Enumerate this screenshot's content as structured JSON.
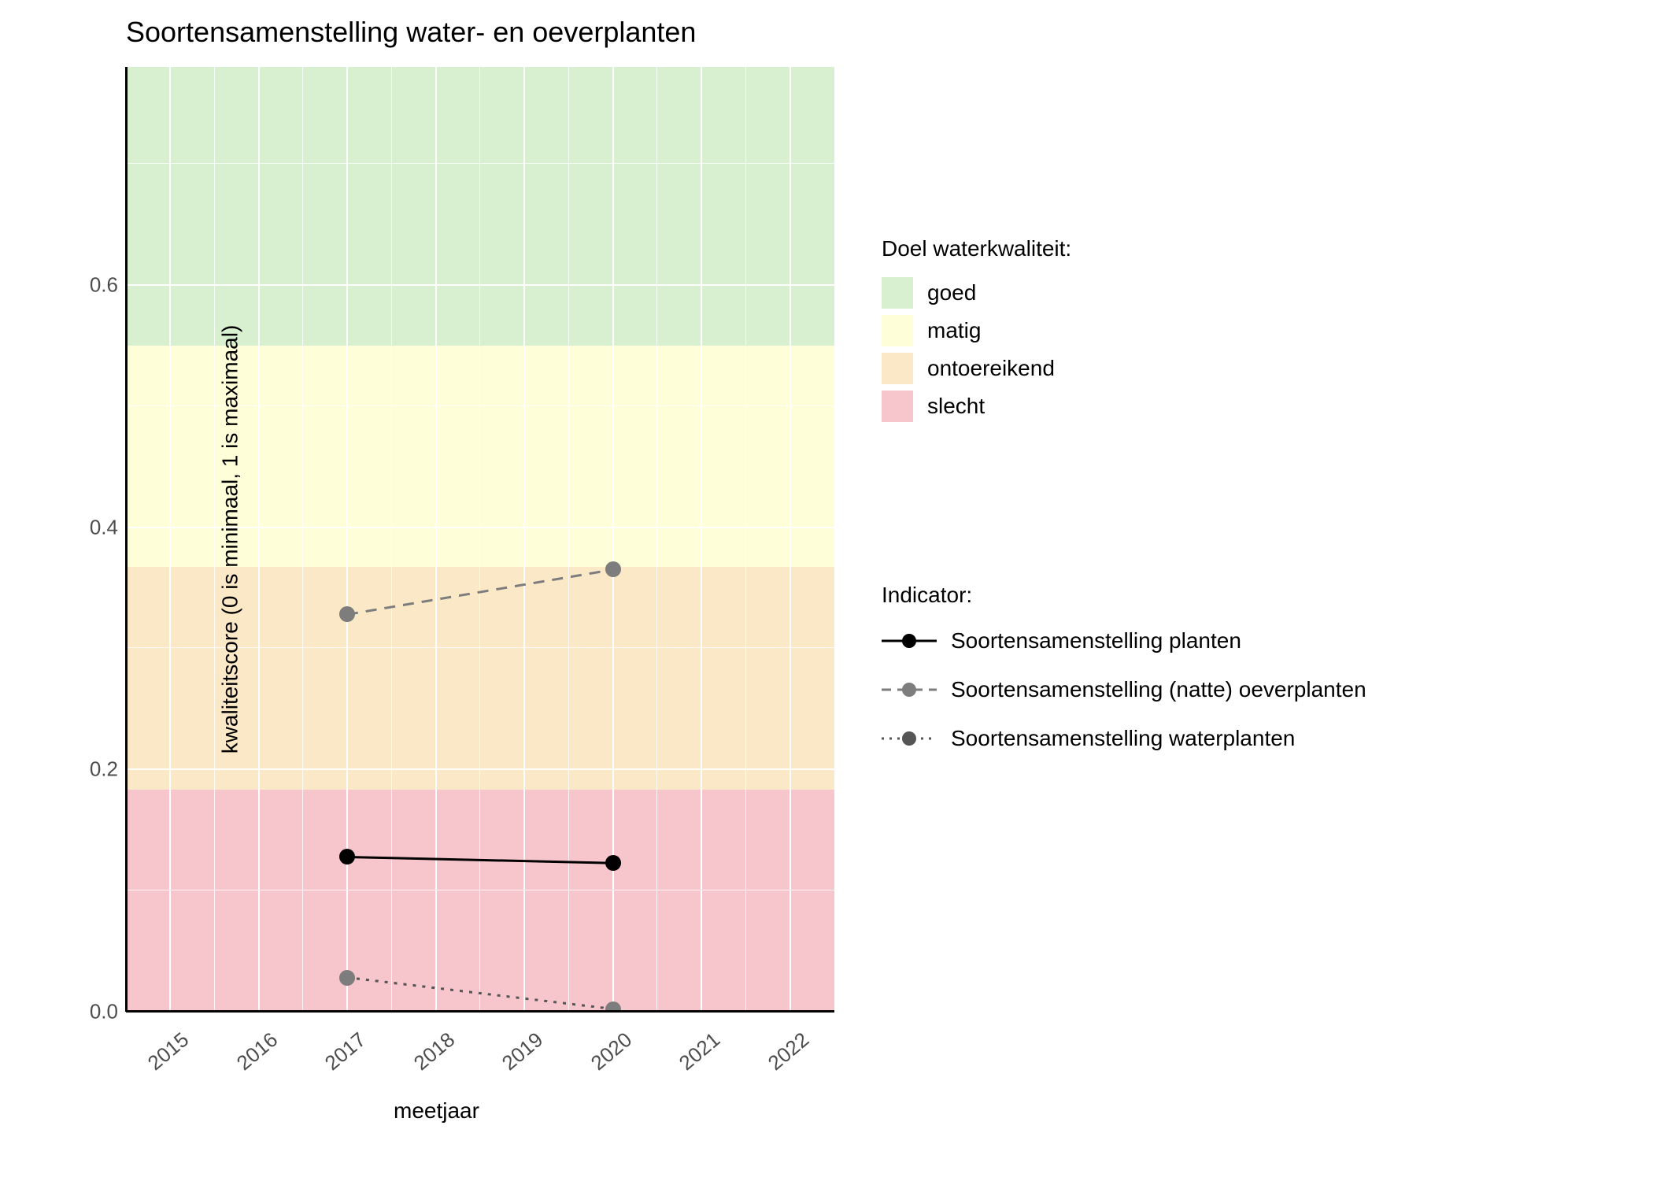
{
  "chart_data": {
    "type": "line",
    "title": "Soortensamenstelling water- en oeverplanten",
    "xlabel": "meetjaar",
    "ylabel": "kwaliteitscore (0 is minimaal, 1 is maximaal)",
    "x_range": [
      2014.5,
      2022.5
    ],
    "x_ticks": [
      2015,
      2016,
      2017,
      2018,
      2019,
      2020,
      2021,
      2022
    ],
    "y_range": [
      0.0,
      0.78
    ],
    "y_ticks": [
      0.0,
      0.2,
      0.4,
      0.6
    ],
    "bands": [
      {
        "name": "slecht",
        "min": 0.0,
        "max": 0.183,
        "color": "#f7c6cc"
      },
      {
        "name": "ontoereikend",
        "min": 0.183,
        "max": 0.367,
        "color": "#fbe8c7"
      },
      {
        "name": "matig",
        "min": 0.367,
        "max": 0.55,
        "color": "#feffd8"
      },
      {
        "name": "goed",
        "min": 0.55,
        "max": 0.78,
        "color": "#d8f0cf"
      }
    ],
    "series": [
      {
        "name": "Soortensamenstelling planten",
        "style": "solid",
        "color": "#000000",
        "x": [
          2017,
          2020
        ],
        "y": [
          0.128,
          0.123
        ]
      },
      {
        "name": "Soortensamenstelling (natte) oeverplanten",
        "style": "dashed",
        "color": "#7d7d7d",
        "x": [
          2017,
          2020
        ],
        "y": [
          0.328,
          0.365
        ]
      },
      {
        "name": "Soortensamenstelling waterplanten",
        "style": "dotted",
        "color": "#555555",
        "x": [
          2017,
          2020
        ],
        "y": [
          0.028,
          0.002
        ]
      }
    ],
    "legend1_title": "Doel waterkwaliteit:",
    "legend1_items": [
      {
        "label": "goed",
        "color": "#d8f0cf"
      },
      {
        "label": "matig",
        "color": "#feffd8"
      },
      {
        "label": "ontoereikend",
        "color": "#fbe8c7"
      },
      {
        "label": "slecht",
        "color": "#f7c6cc"
      }
    ],
    "legend2_title": "Indicator:"
  }
}
